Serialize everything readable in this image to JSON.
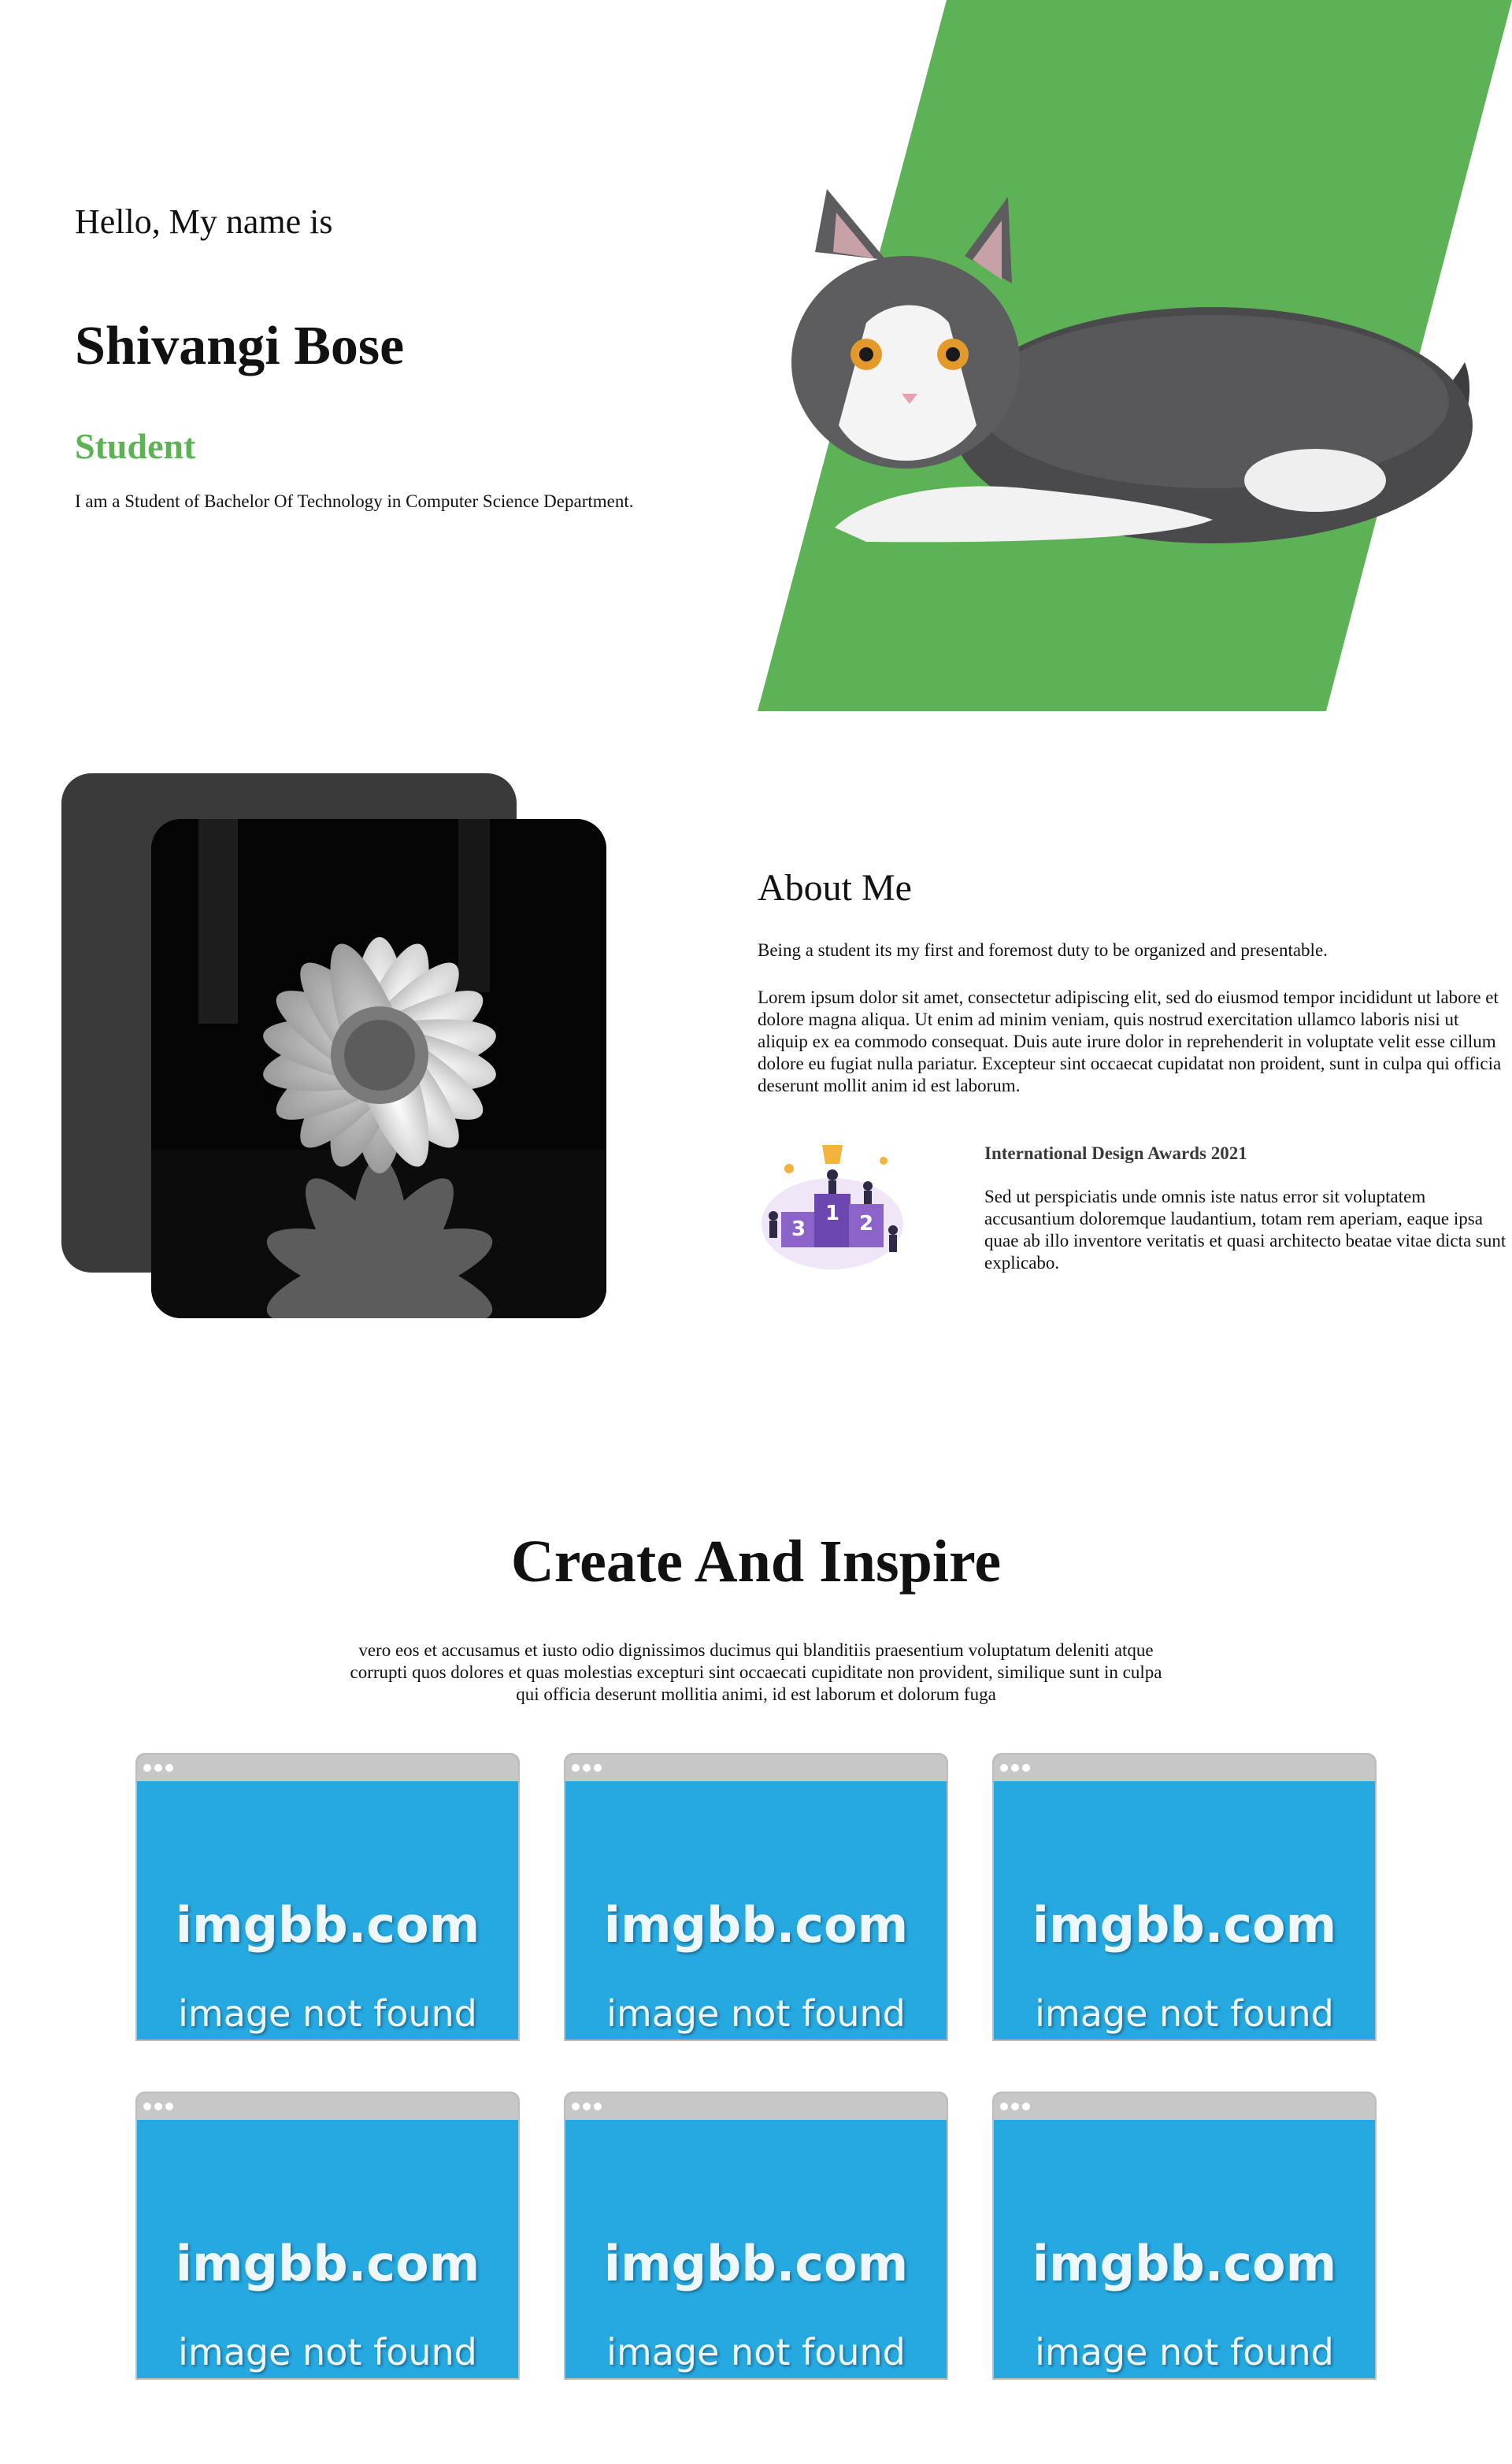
{
  "hero": {
    "greeting": "Hello, My name is",
    "name": "Shivangi Bose",
    "role": "Student",
    "description": "I am a Student of Bachelor Of Technology in Computer Science Department.",
    "accent_color": "#5cb255",
    "image": "cat-photo"
  },
  "about": {
    "title": "About Me",
    "lead": "Being a student its my first and foremost duty to be organized and presentable.",
    "body": "Lorem ipsum dolor sit amet, consectetur adipiscing elit, sed do eiusmod tempor incididunt ut labore et dolore magna aliqua. Ut enim ad minim veniam, quis nostrud exercitation ullamco laboris nisi ut aliquip ex ea commodo consequat. Duis aute irure dolor in reprehenderit in voluptate velit esse cillum dolore eu fugiat nulla pariatur. Excepteur sint occaecat cupidatat non proident, sunt in culpa qui officia deserunt mollit anim id est laborum.",
    "image": "flower-photo",
    "award": {
      "title": "International Design Awards 2021",
      "text": "Sed ut perspiciatis unde omnis iste natus error sit voluptatem accusantium doloremque laudantium, totam rem aperiam, eaque ipsa quae ab illo inventore veritatis et quasi architecto beatae vitae dicta sunt explicabo.",
      "podium_labels": [
        "3",
        "1",
        "2"
      ]
    }
  },
  "create": {
    "title": "Create And Inspire",
    "description": "vero eos et accusamus et iusto odio dignissimos ducimus qui blanditiis praesentium voluptatum deleniti atque corrupti quos dolores et quas molestias excepturi sint occaecati cupiditate non provident, similique sunt in culpa qui officia deserunt mollitia animi, id est laborum et dolorum fuga",
    "cards": [
      {
        "brand": "imgbb.com",
        "message": "image not found"
      },
      {
        "brand": "imgbb.com",
        "message": "image not found"
      },
      {
        "brand": "imgbb.com",
        "message": "image not found"
      },
      {
        "brand": "imgbb.com",
        "message": "image not found"
      },
      {
        "brand": "imgbb.com",
        "message": "image not found"
      },
      {
        "brand": "imgbb.com",
        "message": "image not found"
      }
    ],
    "card_color": "#26a8e0"
  }
}
